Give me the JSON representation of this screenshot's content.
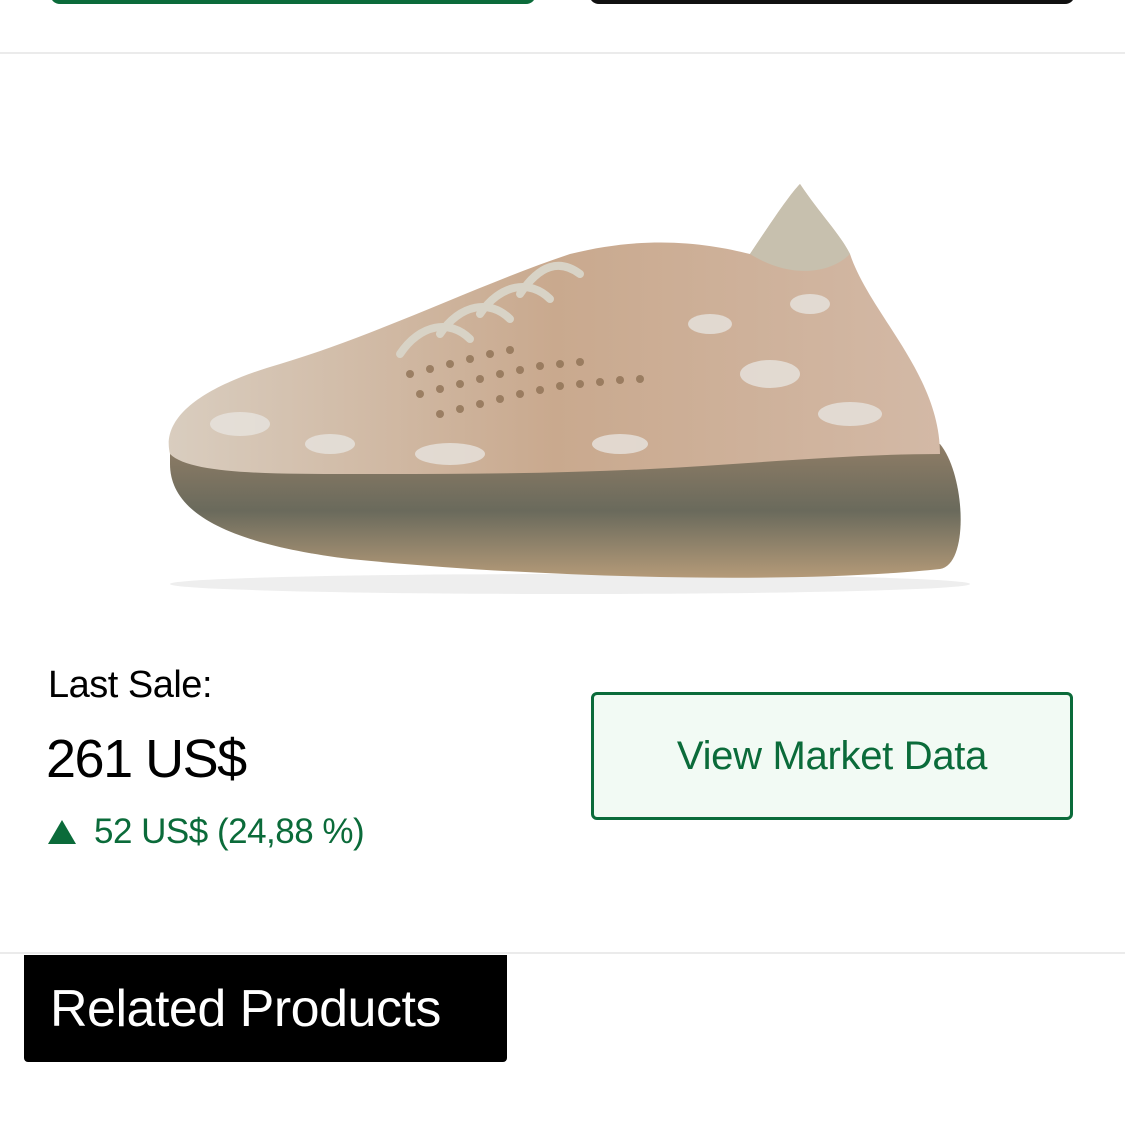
{
  "last_sale": {
    "label": "Last Sale:",
    "price": "261 US$",
    "change_text": "52 US$ (24,88 %)",
    "change_direction": "up",
    "change_icon": "triangle-up-icon"
  },
  "actions": {
    "market_data_label": "View Market Data"
  },
  "related": {
    "title": "Related Products"
  },
  "colors": {
    "accent_green": "#0b6b3a",
    "button_bg": "#f2faf4",
    "dark": "#000000"
  }
}
